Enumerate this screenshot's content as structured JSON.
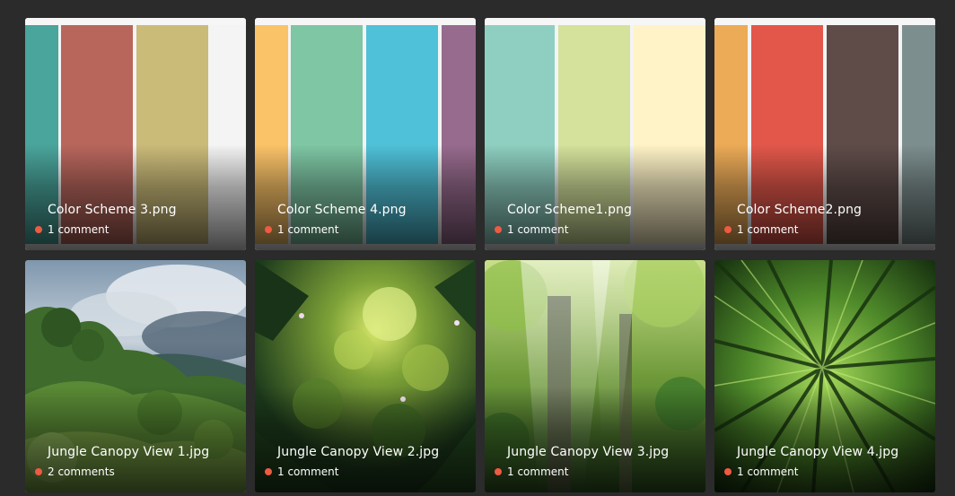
{
  "colors": {
    "background": "#2b2b2b",
    "comment_dot": "#ef5a43"
  },
  "cards": [
    {
      "title": "Color Scheme 3.png",
      "comments": "1 comment",
      "swatches": [
        "#4aa59c",
        "#b8665c",
        "#cbbb79",
        "#f4f4f4"
      ]
    },
    {
      "title": "Color Scheme 4.png",
      "comments": "1 comment",
      "swatches": [
        "#fbc368",
        "#7ec6a4",
        "#4fc1d8",
        "#976b8e"
      ]
    },
    {
      "title": "Color Scheme1.png",
      "comments": "1 comment",
      "swatches": [
        "#8ecfc1",
        "#d4e29c",
        "#fff3c7"
      ]
    },
    {
      "title": "Color Scheme2.png",
      "comments": "1 comment",
      "swatches": [
        "#ecab57",
        "#e2574a",
        "#5f4c49",
        "#7d8e8e"
      ]
    },
    {
      "title": "Jungle Canopy View 1.jpg",
      "comments": "2 comments",
      "image": "jungle-hills-image"
    },
    {
      "title": "Jungle Canopy View 2.jpg",
      "comments": "1 comment",
      "image": "jungle-foliage-image"
    },
    {
      "title": "Jungle Canopy View 3.jpg",
      "comments": "1 comment",
      "image": "jungle-sunrays-image"
    },
    {
      "title": "Jungle Canopy View 4.jpg",
      "comments": "1 comment",
      "image": "palm-leaves-image"
    }
  ]
}
